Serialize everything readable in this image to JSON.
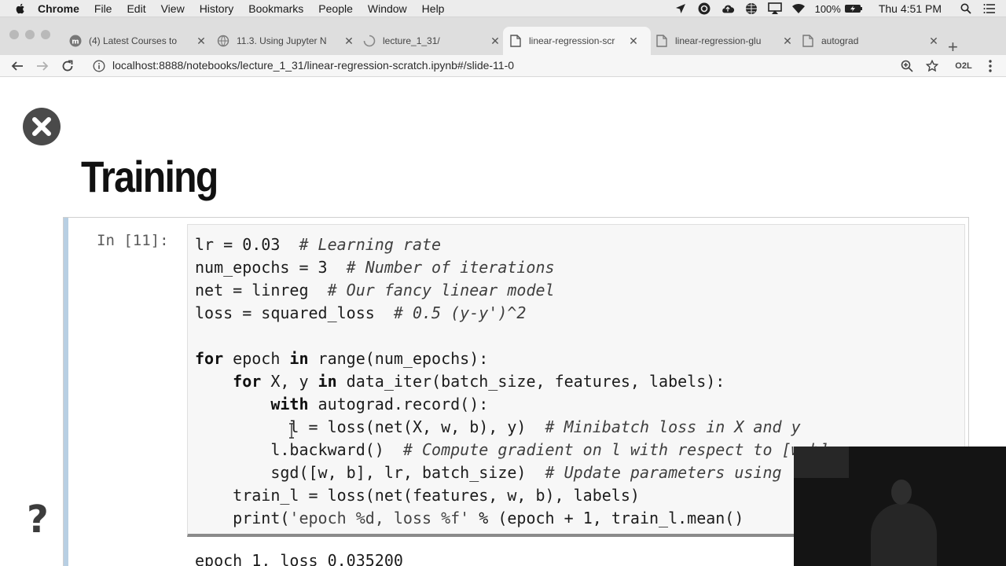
{
  "menubar": {
    "app_name": "Chrome",
    "items": [
      "File",
      "Edit",
      "View",
      "History",
      "Bookmarks",
      "People",
      "Window",
      "Help"
    ],
    "status_icons": [
      "location-icon",
      "creative-cloud-icon",
      "cloud-icon",
      "globe-icon",
      "airplay-icon",
      "wifi-icon"
    ],
    "battery": "100%",
    "clock": "Thu 4:51 PM"
  },
  "tabs": [
    {
      "title": "(4) Latest Courses to",
      "icon": "m-logo-icon",
      "active": false
    },
    {
      "title": "11.3. Using Jupyter N",
      "icon": "globe-icon",
      "active": false
    },
    {
      "title": "lecture_1_31/",
      "icon": "loading-icon",
      "active": false
    },
    {
      "title": "linear-regression-scr",
      "icon": "page-icon",
      "active": true
    },
    {
      "title": "linear-regression-glu",
      "icon": "page-icon",
      "active": false
    },
    {
      "title": "autograd",
      "icon": "page-icon",
      "active": false
    }
  ],
  "toolbar": {
    "url": "localhost:8888/notebooks/lecture_1_31/linear-regression-scratch.ipynb#/slide-11-0",
    "extension_label": "O2L"
  },
  "slide": {
    "title": "Training",
    "prompt": "In [11]:",
    "code_lines": [
      [
        {
          "t": "lr = 0.03  ",
          "c": ""
        },
        {
          "t": "# Learning rate",
          "c": "cm"
        }
      ],
      [
        {
          "t": "num_epochs = 3  ",
          "c": ""
        },
        {
          "t": "# Number of iterations",
          "c": "cm"
        }
      ],
      [
        {
          "t": "net = linreg  ",
          "c": ""
        },
        {
          "t": "# Our fancy linear model",
          "c": "cm"
        }
      ],
      [
        {
          "t": "loss = squared_loss  ",
          "c": ""
        },
        {
          "t": "# 0.5 (y-y')^2",
          "c": "cm"
        }
      ],
      [
        {
          "t": "",
          "c": ""
        }
      ],
      [
        {
          "t": "for",
          "c": "kw"
        },
        {
          "t": " epoch ",
          "c": ""
        },
        {
          "t": "in",
          "c": "kw"
        },
        {
          "t": " range(num_epochs):",
          "c": ""
        }
      ],
      [
        {
          "t": "    ",
          "c": ""
        },
        {
          "t": "for",
          "c": "kw"
        },
        {
          "t": " X, y ",
          "c": ""
        },
        {
          "t": "in",
          "c": "kw"
        },
        {
          "t": " data_iter(batch_size, features, labels):",
          "c": ""
        }
      ],
      [
        {
          "t": "        ",
          "c": ""
        },
        {
          "t": "with",
          "c": "kw"
        },
        {
          "t": " autograd.record():",
          "c": ""
        }
      ],
      [
        {
          "t": "          l = loss(net(X, w, b), y)  ",
          "c": ""
        },
        {
          "t": "# Minibatch loss in X and y",
          "c": "cm"
        }
      ],
      [
        {
          "t": "        l.backward()  ",
          "c": ""
        },
        {
          "t": "# Compute gradient on l with respect to [w,b]",
          "c": "cm"
        }
      ],
      [
        {
          "t": "        sgd([w, b], lr, batch_size)  ",
          "c": ""
        },
        {
          "t": "# Update parameters using",
          "c": "cm"
        }
      ],
      [
        {
          "t": "    train_l = loss(net(features, w, b), labels)",
          "c": ""
        }
      ],
      [
        {
          "t": "    print(",
          "c": ""
        },
        {
          "t": "'epoch %d, loss %f'",
          "c": "str"
        },
        {
          "t": " % (epoch + 1, train_l.mean()",
          "c": ""
        }
      ]
    ],
    "output": "epoch 1, loss 0.035200"
  }
}
